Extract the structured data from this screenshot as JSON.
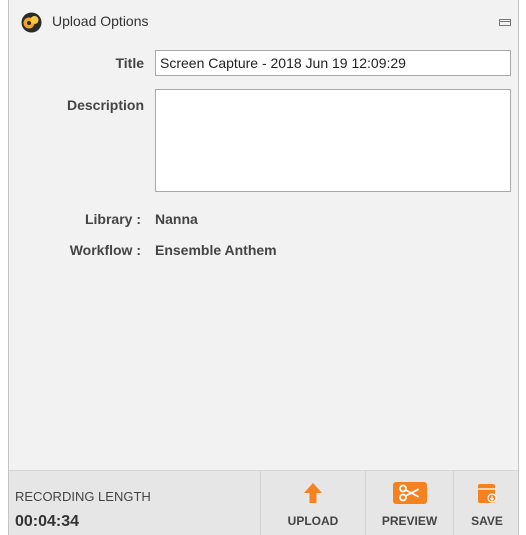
{
  "window": {
    "title": "Upload Options"
  },
  "form": {
    "title_label": "Title",
    "title_value": "Screen Capture - 2018 Jun 19 12:09:29",
    "description_label": "Description",
    "description_value": "",
    "library_label": "Library :",
    "library_value": "Nanna",
    "workflow_label": "Workflow :",
    "workflow_value": "Ensemble Anthem"
  },
  "footer": {
    "recording_length_label": "RECORDING LENGTH",
    "recording_length_value": "00:04:34",
    "buttons": [
      {
        "label": "UPLOAD",
        "icon": "upload-arrow-icon"
      },
      {
        "label": "PREVIEW",
        "icon": "scissors-icon"
      },
      {
        "label": "SAVE",
        "icon": "save-folder-icon"
      }
    ]
  },
  "colors": {
    "accent": "#f5821f",
    "background": "#f2f2f2",
    "footer_background": "#e6e6e6",
    "text": "#444444"
  }
}
